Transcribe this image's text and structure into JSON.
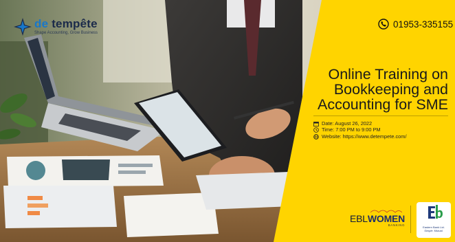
{
  "brand": {
    "name_prefix": "de",
    "name_main": "tempête",
    "tagline": "Shape Accounting, Grow Business"
  },
  "contact": {
    "phone_icon": "phone-icon",
    "phone": "01953-335155"
  },
  "event": {
    "title_lines": [
      "Online Training on",
      "Bookkeeping and",
      "Accounting for SME"
    ],
    "date_icon": "calendar-icon",
    "date": "Date: August 26, 2022",
    "time_icon": "clock-icon",
    "time": "Time: 7:00 PM to 9:00 PM",
    "website_icon": "globe-icon",
    "website": "Website: https://www.detempete.com/"
  },
  "partners": {
    "ebl_prefix": "EBL",
    "ebl_women": "WOMEN",
    "ebl_sub": "BANKING",
    "bank_name": "Eastern Bank Ltd.",
    "bank_slogan": "Simple. Mutual."
  },
  "colors": {
    "accent_yellow": "#ffd400",
    "brand_blue": "#1877c9",
    "brand_navy": "#1b2a4a"
  }
}
